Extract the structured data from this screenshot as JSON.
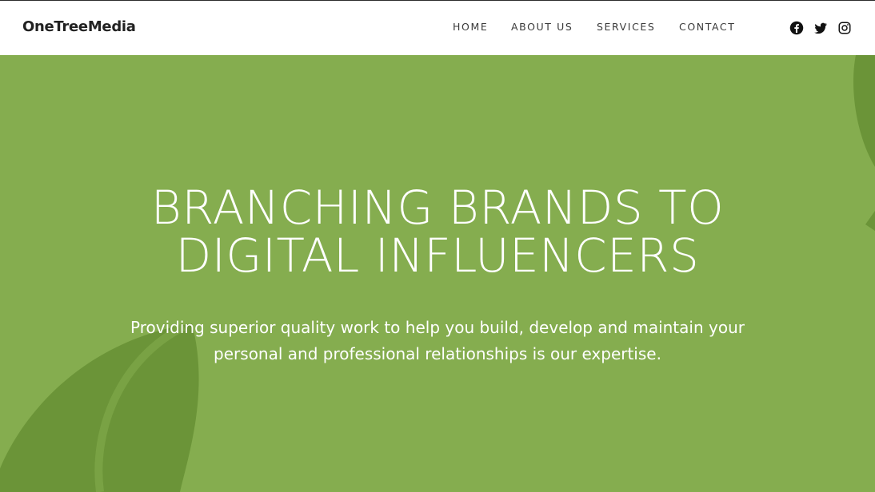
{
  "brand": {
    "name": "OneTreeMedia"
  },
  "nav": {
    "items": [
      {
        "label": "HOME"
      },
      {
        "label": "ABOUT US"
      },
      {
        "label": "SERVICES"
      },
      {
        "label": "CONTACT"
      }
    ]
  },
  "social": [
    {
      "icon": "facebook-icon"
    },
    {
      "icon": "twitter-icon"
    },
    {
      "icon": "instagram-icon"
    }
  ],
  "hero": {
    "title_line1": "BRANCHING BRANDS TO",
    "title_line2": "DIGITAL INFLUENCERS",
    "subtitle_line1": "Providing superior quality work to help you build, develop and maintain your",
    "subtitle_line2": "personal and professional relationships is our expertise."
  },
  "colors": {
    "hero_background": "#85ad4f",
    "leaf_dark": "#6b9438",
    "nav_text": "#3a3a3a",
    "brand_text": "#222222"
  }
}
